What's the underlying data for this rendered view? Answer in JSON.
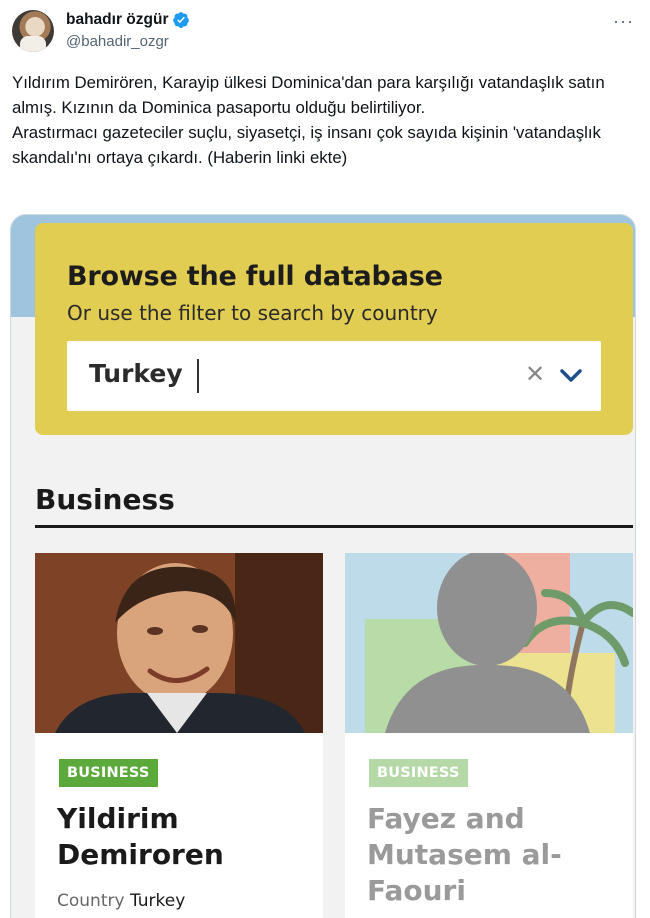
{
  "tweet": {
    "display_name": "bahadır özgür",
    "handle": "@bahadir_ozgr",
    "text_line_1": "Yıldırım Demirören, Karayip ülkesi Dominica'dan para karşılığı vatandaşlık satın almış. Kızının da Dominica pasaportu olduğu belirtiliyor.",
    "text_line_2": "Arastırmacı gazeteciler suçlu, siyasetçi, iş insanı çok sayıda kişinin 'vatandaşlık skandalı'nı ortaya çıkardı. (Haberin linki ekte)",
    "more_icon": "more-horizontal-icon",
    "verified_icon": "verified-badge-icon"
  },
  "media": {
    "db_title": "Browse the full database",
    "db_subtitle": "Or use the filter to search by country",
    "search_value": "Turkey",
    "clear_icon": "clear-icon",
    "dropdown_icon": "chevron-down-icon",
    "section_title": "Business",
    "cards": [
      {
        "badge": "BUSINESS",
        "name": "Yildirim Demiroren",
        "country_label": "Country",
        "country_value": "Turkey"
      },
      {
        "badge": "BUSINESS",
        "name": "Fayez and Mutasem al-Faouri"
      }
    ]
  },
  "colors": {
    "accent_yellow": "#e2cd53",
    "badge_green": "#5aa93a",
    "verified_blue": "#1d9bf0"
  }
}
